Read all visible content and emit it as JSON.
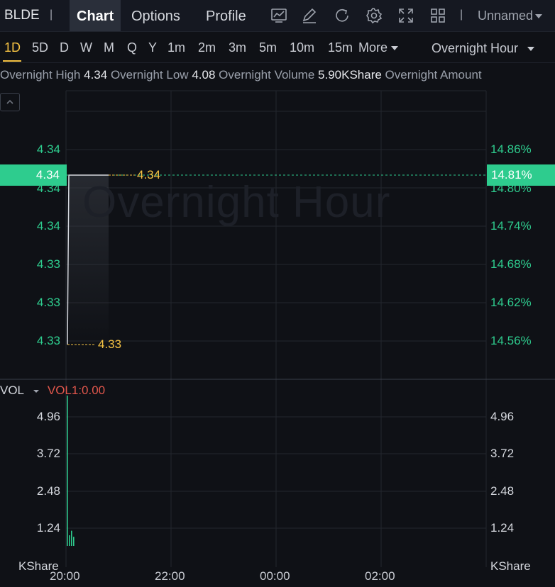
{
  "header": {
    "ticker": "BLDE",
    "separator": "|",
    "tabs": [
      {
        "label": "Chart",
        "active": true
      },
      {
        "label": "Options",
        "active": false
      },
      {
        "label": "Profile",
        "active": false
      }
    ],
    "tool_icons": [
      "indicator-chart-icon",
      "draw-pen-icon",
      "refresh-icon",
      "settings-gear-icon",
      "fullscreen-icon",
      "layout-grid-icon"
    ],
    "layout_name": "Unnamed"
  },
  "periods": {
    "items": [
      "1D",
      "5D",
      "D",
      "W",
      "M",
      "Q",
      "Y",
      "1m",
      "2m",
      "3m",
      "5m",
      "10m",
      "15m"
    ],
    "active": "1D",
    "more_label": "More",
    "session_label": "Overnight Hour"
  },
  "stats": {
    "high_label": "Overnight High",
    "high_value": "4.34",
    "low_label": "Overnight Low",
    "low_value": "4.08",
    "volume_label": "Overnight Volume",
    "volume_value": "5.90KShare",
    "amount_label": "Overnight Amount"
  },
  "price_chart": {
    "watermark": "Overnight Hour",
    "left_ticks": [
      "4.34",
      "4.34",
      "4.34",
      "4.33",
      "4.33",
      "4.33"
    ],
    "right_ticks": [
      "14.86%",
      "14.80%",
      "14.74%",
      "14.68%",
      "14.62%",
      "14.56%"
    ],
    "current_price": "4.34",
    "current_pct": "14.81%",
    "high_marker": "4.34",
    "low_marker": "4.33",
    "accent_color": "#2ecc8e",
    "marker_color": "#f6c343"
  },
  "volume_chart": {
    "indicator_name": "VOL",
    "indicator_value": "VOL1:0.00",
    "ticks": [
      "4.96",
      "3.72",
      "2.48",
      "1.24"
    ],
    "unit": "KShare",
    "bars_kshare": [
      4.96,
      0.35,
      0.5,
      0.3
    ]
  },
  "time_axis": [
    "20:00",
    "22:00",
    "00:00",
    "02:00"
  ]
}
